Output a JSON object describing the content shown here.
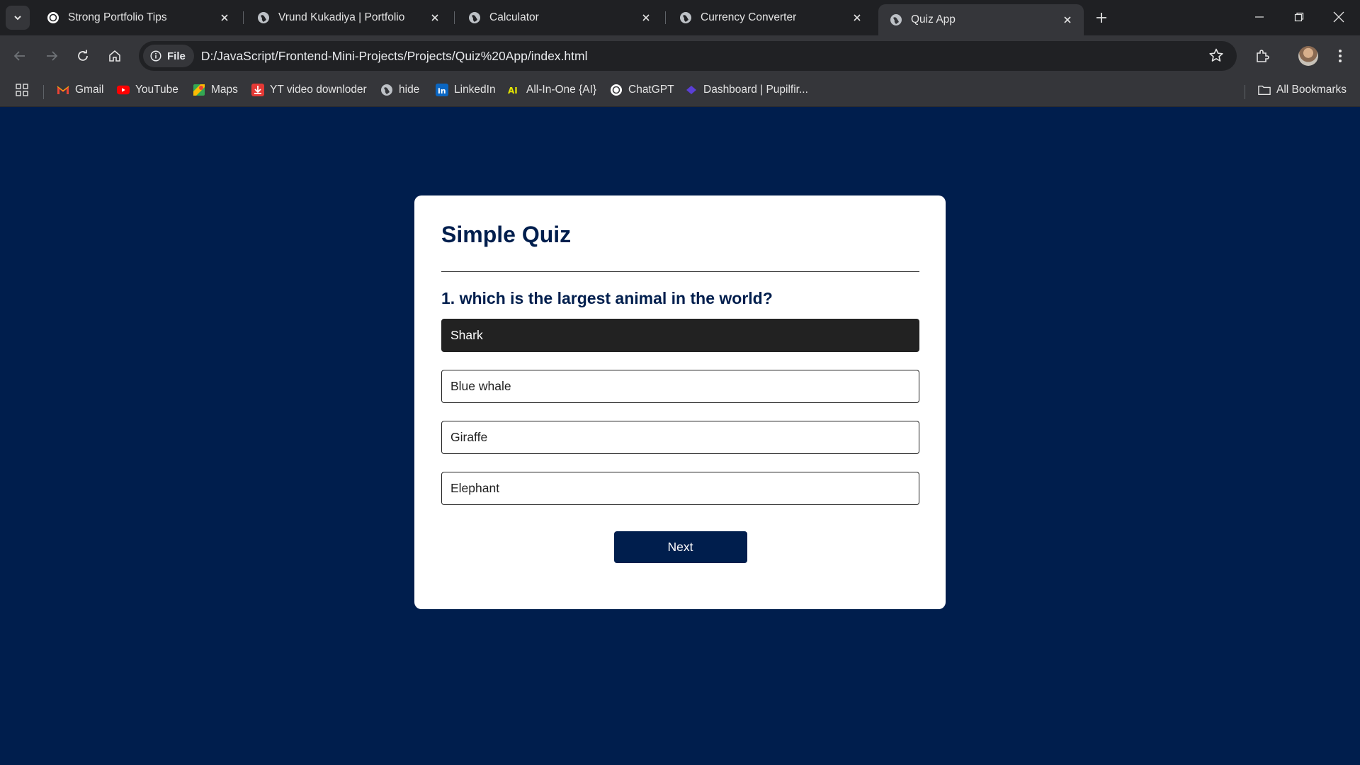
{
  "browser": {
    "tabs": [
      {
        "title": "Strong Portfolio Tips",
        "favicon": "chatgpt-icon"
      },
      {
        "title": "Vrund Kukadiya | Portfolio",
        "favicon": "globe-icon"
      },
      {
        "title": "Calculator",
        "favicon": "globe-icon"
      },
      {
        "title": "Currency Converter",
        "favicon": "globe-icon"
      },
      {
        "title": "Quiz App",
        "favicon": "globe-icon",
        "active": true
      }
    ],
    "address": {
      "scheme_chip": "File",
      "url": "D:/JavaScript/Frontend-Mini-Projects/Projects/Quiz%20App/index.html"
    },
    "bookmarks": [
      {
        "label": "Gmail",
        "icon": "gmail-icon"
      },
      {
        "label": "YouTube",
        "icon": "youtube-icon"
      },
      {
        "label": "Maps",
        "icon": "maps-icon"
      },
      {
        "label": "YT video downloder",
        "icon": "download-icon"
      },
      {
        "label": "hide",
        "icon": "globe-icon"
      },
      {
        "label": "LinkedIn",
        "icon": "linkedin-icon"
      },
      {
        "label": "All-In-One {AI}",
        "icon": "ai-icon"
      },
      {
        "label": "ChatGPT",
        "icon": "chatgpt-icon"
      },
      {
        "label": "Dashboard | Pupilfir...",
        "icon": "pupilfirst-icon"
      }
    ],
    "all_bookmarks": "All Bookmarks"
  },
  "quiz": {
    "title": "Simple Quiz",
    "question": "1. which is the largest animal in the world?",
    "answers": [
      {
        "text": "Shark",
        "selected": true
      },
      {
        "text": "Blue whale",
        "selected": false
      },
      {
        "text": "Giraffe",
        "selected": false
      },
      {
        "text": "Elephant",
        "selected": false
      }
    ],
    "next_label": "Next"
  },
  "colors": {
    "page_bg": "#001e4d",
    "card_bg": "#ffffff",
    "selected_answer_bg": "#222222",
    "button_bg": "#001e4d"
  }
}
